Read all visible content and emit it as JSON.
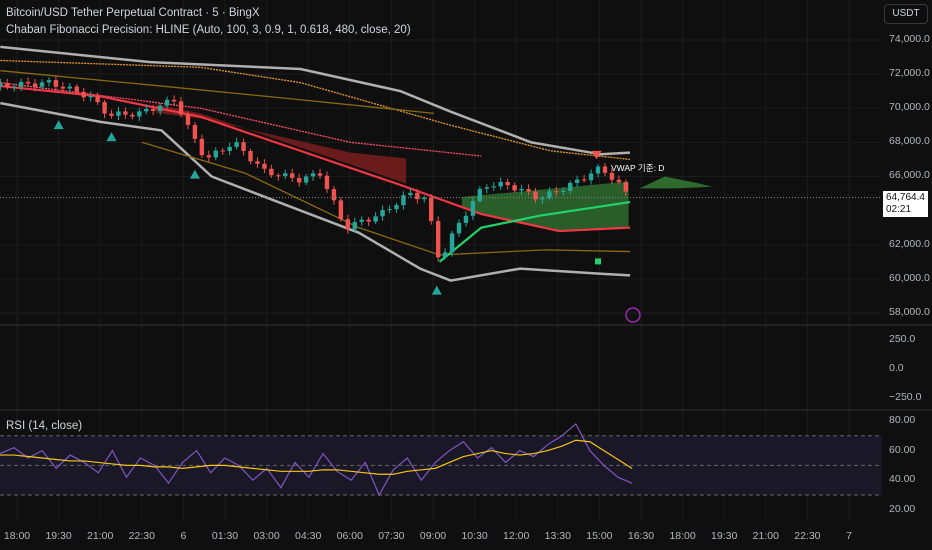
{
  "header": {
    "title": "Bitcoin/USD Tether Perpetual Contract · 5 · BingX",
    "indicator": "Chaban Fibonacci Precision: HLINE (Auto, 100, 3, 0.9, 1, 0.618, 480, close, 20)",
    "currency": "USDT"
  },
  "last_price": {
    "value": "64,764.4",
    "countdown": "02:21"
  },
  "vwap_label": "VWAP 기준: D",
  "rsi_title": "RSI (14, close)",
  "colors": {
    "bg": "#0f0f0f",
    "up": "#26a69a",
    "down": "#ef5350",
    "ma": "#f23645",
    "bands": "#b0b0b0",
    "orange": "#e39a2a",
    "green": "#22d36b",
    "rsi": "#7e57c2",
    "rsi_ma": "#f5c518"
  },
  "chart_data": {
    "type": "line",
    "title": "Bitcoin/USD Tether Perpetual Contract · 5 · BingX",
    "x_unit": "hours from 18:00",
    "y_ticks": [
      "74,000.0",
      "72,000.0",
      "70,000.0",
      "68,000.0",
      "66,000.0",
      "62,000.0",
      "60,000.0",
      "58,000.0"
    ],
    "y_tick_values": [
      74000,
      72000,
      70000,
      68000,
      66000,
      62000,
      60000,
      58000
    ],
    "ylim": [
      57500,
      75100
    ],
    "osc_ticks": [
      "250.0",
      "0.0",
      "−250.0"
    ],
    "rsi_ticks": [
      "80.00",
      "60.00",
      "40.00",
      "20.00"
    ],
    "x_ticks": [
      "18:00",
      "19:30",
      "21:00",
      "22:30",
      "6",
      "01:30",
      "03:00",
      "04:30",
      "06:00",
      "07:30",
      "09:00",
      "10:30",
      "12:00",
      "13:30",
      "15:00",
      "16:30",
      "18:00",
      "19:30",
      "21:00",
      "22:30",
      "7"
    ],
    "price": [
      [
        -0.6,
        71300
      ],
      [
        1.2,
        71500
      ],
      [
        2.6,
        70700
      ],
      [
        3.3,
        69600
      ],
      [
        4.4,
        69700
      ],
      [
        5.7,
        70500
      ],
      [
        6.2,
        68700
      ],
      [
        6.8,
        67000
      ],
      [
        7.8,
        68000
      ],
      [
        8.9,
        66300
      ],
      [
        10.2,
        65800
      ],
      [
        10.9,
        66200
      ],
      [
        11.8,
        63000
      ],
      [
        13.1,
        63800
      ],
      [
        14.1,
        65000
      ],
      [
        14.7,
        64700
      ],
      [
        15.2,
        61000
      ],
      [
        15.8,
        63000
      ],
      [
        16.8,
        65500
      ],
      [
        17.7,
        65500
      ],
      [
        18.8,
        64700
      ],
      [
        19.9,
        65500
      ],
      [
        21,
        66500
      ],
      [
        21.5,
        65800
      ],
      [
        22.05,
        64764
      ]
    ],
    "series": [
      {
        "name": "Upper band",
        "color": "#b0b0b0",
        "points": [
          [
            -0.6,
            73600
          ],
          [
            4.8,
            72700
          ],
          [
            10.2,
            72300
          ],
          [
            13.8,
            71000
          ],
          [
            15.6,
            69800
          ],
          [
            18.5,
            68000
          ],
          [
            21,
            67300
          ],
          [
            22.05,
            67400
          ]
        ]
      },
      {
        "name": "Lower band",
        "color": "#b0b0b0",
        "points": [
          [
            -0.6,
            70300
          ],
          [
            3,
            69200
          ],
          [
            5.2,
            68700
          ],
          [
            7,
            66000
          ],
          [
            10.2,
            64000
          ],
          [
            12.3,
            62700
          ],
          [
            14.5,
            60600
          ],
          [
            15.6,
            59900
          ],
          [
            18.1,
            60600
          ],
          [
            21,
            60300
          ],
          [
            22.05,
            60200
          ]
        ]
      },
      {
        "name": "Fib upper",
        "color": "#e39a2a",
        "points": [
          [
            -0.6,
            72800
          ],
          [
            6.6,
            72400
          ],
          [
            10.2,
            71500
          ],
          [
            15.6,
            69000
          ],
          [
            19.2,
            67500
          ],
          [
            22.05,
            67000
          ]
        ]
      },
      {
        "name": "Fib mid",
        "color": "#8a6a10",
        "points": [
          [
            -0.6,
            72200
          ],
          [
            5.2,
            71300
          ],
          [
            10.2,
            70500
          ],
          [
            15,
            69700
          ]
        ]
      },
      {
        "name": "Fib lower",
        "color": "#8a6a10",
        "points": [
          [
            4.5,
            68000
          ],
          [
            8.2,
            66200
          ],
          [
            12.3,
            63000
          ],
          [
            15.2,
            61400
          ],
          [
            19,
            61700
          ],
          [
            22.05,
            61600
          ]
        ]
      },
      {
        "name": "Trail",
        "color": "#ff4d6d",
        "points": [
          [
            -0.6,
            71500
          ],
          [
            6.6,
            70000
          ],
          [
            12,
            68000
          ],
          [
            16.7,
            67200
          ]
        ]
      },
      {
        "name": "MA",
        "color": "#f23645",
        "points": [
          [
            -0.6,
            71300
          ],
          [
            3,
            70700
          ],
          [
            6.6,
            69500
          ],
          [
            10.2,
            67500
          ],
          [
            13.8,
            65500
          ],
          [
            16.7,
            63800
          ],
          [
            19.5,
            62800
          ],
          [
            22.05,
            63000
          ]
        ]
      },
      {
        "name": "VWAP",
        "color": "#22d36b",
        "points": [
          [
            15.2,
            61000
          ],
          [
            16.7,
            63000
          ],
          [
            18.8,
            63700
          ],
          [
            22.05,
            64500
          ]
        ]
      }
    ],
    "rsi": [
      58,
      62,
      55,
      60,
      48,
      57,
      52,
      45,
      60,
      42,
      55,
      50,
      38,
      52,
      60,
      45,
      55,
      50,
      40,
      48,
      35,
      52,
      42,
      58,
      46,
      40,
      52,
      30,
      47,
      55,
      40,
      52,
      60,
      66,
      55,
      62,
      52,
      60,
      56,
      64,
      70,
      78,
      60,
      50,
      42,
      38
    ],
    "rsi_ma": [
      57,
      57,
      56,
      55,
      54,
      53,
      53,
      52,
      51,
      50,
      50,
      49,
      49,
      48,
      49,
      50,
      50,
      49,
      48,
      47,
      46,
      46,
      46,
      47,
      47,
      46,
      45,
      44,
      44,
      46,
      47,
      48,
      52,
      56,
      58,
      60,
      58,
      57,
      58,
      60,
      63,
      67,
      66,
      60,
      54,
      48
    ],
    "rsi_levels": [
      70,
      50,
      30
    ]
  }
}
